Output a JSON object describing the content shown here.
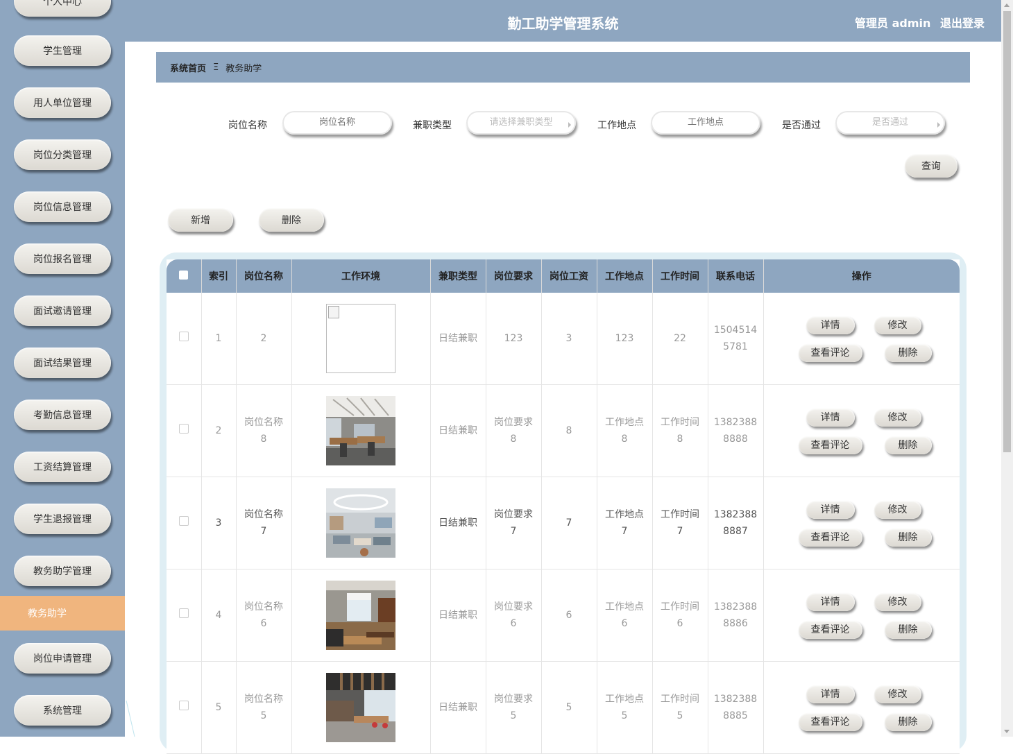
{
  "header": {
    "title": "勤工助学管理系统",
    "admin_label": "管理员 admin",
    "logout_label": "退出登录"
  },
  "sidebar": {
    "items": [
      {
        "label": "个人中心"
      },
      {
        "label": "学生管理"
      },
      {
        "label": "用人单位管理"
      },
      {
        "label": "岗位分类管理"
      },
      {
        "label": "岗位信息管理"
      },
      {
        "label": "岗位报名管理"
      },
      {
        "label": "面试邀请管理"
      },
      {
        "label": "面试结果管理"
      },
      {
        "label": "考勤信息管理"
      },
      {
        "label": "工资结算管理"
      },
      {
        "label": "学生退报管理"
      },
      {
        "label": "教务助学管理"
      },
      {
        "label": "岗位申请管理"
      },
      {
        "label": "系统管理"
      }
    ],
    "active_item": "教务助学"
  },
  "breadcrumb": {
    "home": "系统首页",
    "separator": "Ξ",
    "current": "教务助学"
  },
  "search": {
    "job_name_label": "岗位名称",
    "job_name_placeholder": "岗位名称",
    "job_type_label": "兼职类型",
    "job_type_placeholder": "请选择兼职类型",
    "location_label": "工作地点",
    "location_placeholder": "工作地点",
    "passed_label": "是否通过",
    "passed_placeholder": "是否通过",
    "query_button": "查询"
  },
  "actions": {
    "add_button": "新增",
    "delete_button": "删除"
  },
  "table": {
    "columns": [
      "索引",
      "岗位名称",
      "工作环境",
      "兼职类型",
      "岗位要求",
      "岗位工资",
      "工作地点",
      "工作时间",
      "联系电话",
      "操作"
    ],
    "row_buttons": {
      "detail": "详情",
      "edit": "修改",
      "comments": "查看评论",
      "delete": "删除"
    },
    "rows": [
      {
        "index": "1",
        "name": [
          "2"
        ],
        "type": "日结兼职",
        "requirement": [
          "123"
        ],
        "salary": "3",
        "location": [
          "123"
        ],
        "time": [
          "22"
        ],
        "phone": [
          "1504514",
          "5781"
        ],
        "image": "broken"
      },
      {
        "index": "2",
        "name": [
          "岗位名称",
          "8"
        ],
        "type": "日结兼职",
        "requirement": [
          "岗位要求",
          "8"
        ],
        "salary": "8",
        "location": [
          "工作地点",
          "8"
        ],
        "time": [
          "工作时间",
          "8"
        ],
        "phone": [
          "1382388",
          "8888"
        ],
        "image": "office-open"
      },
      {
        "index": "3",
        "name": [
          "岗位名称",
          "7"
        ],
        "type": "日结兼职",
        "requirement": [
          "岗位要求",
          "7"
        ],
        "salary": "7",
        "location": [
          "工作地点",
          "7"
        ],
        "time": [
          "工作时间",
          "7"
        ],
        "phone": [
          "1382388",
          "8887"
        ],
        "image": "lounge"
      },
      {
        "index": "4",
        "name": [
          "岗位名称",
          "6"
        ],
        "type": "日结兼职",
        "requirement": [
          "岗位要求",
          "6"
        ],
        "salary": "6",
        "location": [
          "工作地点",
          "6"
        ],
        "time": [
          "工作时间",
          "6"
        ],
        "phone": [
          "1382388",
          "8886"
        ],
        "image": "office-room"
      },
      {
        "index": "5",
        "name": [
          "岗位名称",
          "5"
        ],
        "type": "日结兼职",
        "requirement": [
          "岗位要求",
          "5"
        ],
        "salary": "5",
        "location": [
          "工作地点",
          "5"
        ],
        "time": [
          "工作时间",
          "5"
        ],
        "phone": [
          "1382388",
          "8885"
        ],
        "image": "office-hall"
      }
    ]
  },
  "colors": {
    "primary": "#8ea6c0",
    "active": "#f0b57e",
    "table_frame": "#dfeef4"
  }
}
